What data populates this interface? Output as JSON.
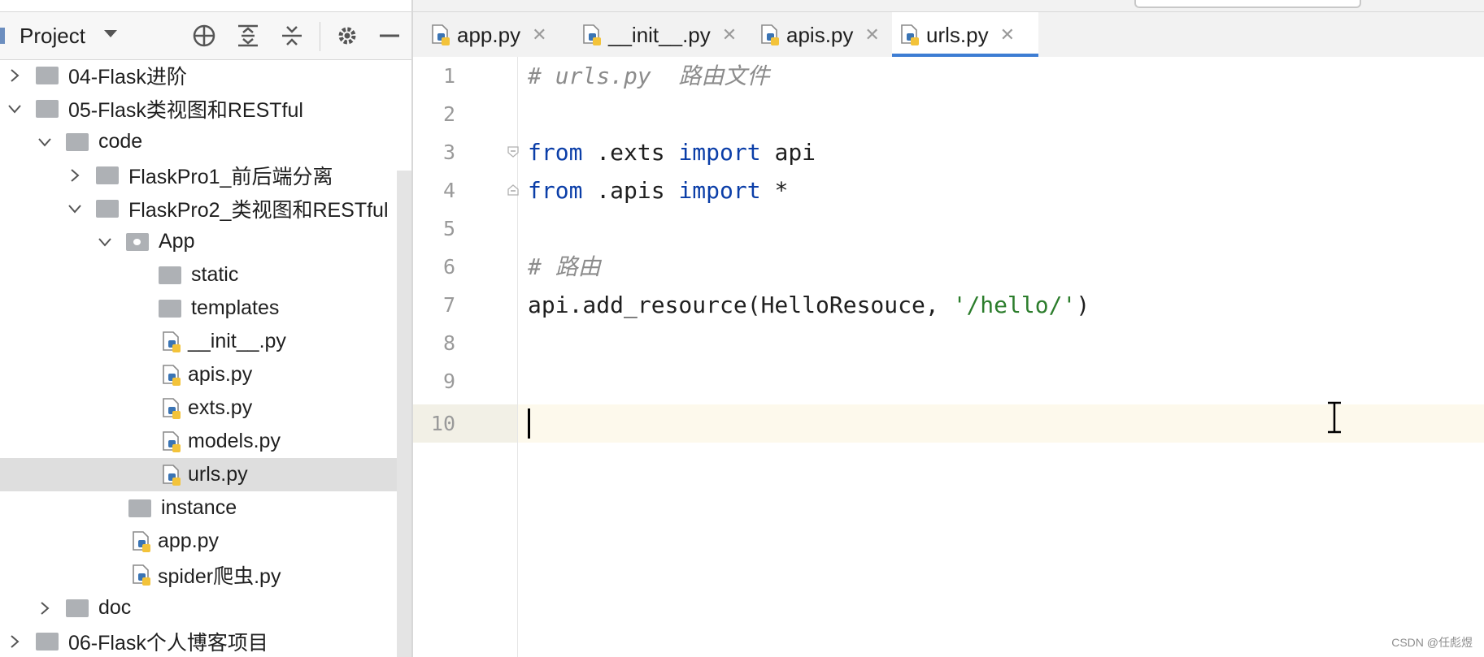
{
  "project_panel": {
    "title": "Project",
    "toolbar_icons": [
      "target-icon",
      "expand-all-icon",
      "collapse-all-icon",
      "gear-icon",
      "minimize-icon"
    ],
    "tree": [
      {
        "label": "04-Flask进阶",
        "type": "folder",
        "level": 0,
        "expanded": false
      },
      {
        "label": "05-Flask类视图和RESTful",
        "type": "folder",
        "level": 0,
        "expanded": true
      },
      {
        "label": "code",
        "type": "folder",
        "level": 1,
        "expanded": true
      },
      {
        "label": "FlaskPro1_前后端分离",
        "type": "folder",
        "level": 2,
        "expanded": false
      },
      {
        "label": "FlaskPro2_类视图和RESTful",
        "type": "folder",
        "level": 2,
        "expanded": true
      },
      {
        "label": "App",
        "type": "package",
        "level": 3,
        "expanded": true
      },
      {
        "label": "static",
        "type": "folder",
        "level": 4
      },
      {
        "label": "templates",
        "type": "folder",
        "level": 4
      },
      {
        "label": "__init__.py",
        "type": "python",
        "level": 4
      },
      {
        "label": "apis.py",
        "type": "python",
        "level": 4
      },
      {
        "label": "exts.py",
        "type": "python",
        "level": 4
      },
      {
        "label": "models.py",
        "type": "python",
        "level": 4
      },
      {
        "label": "urls.py",
        "type": "python",
        "level": 4,
        "selected": true
      },
      {
        "label": "instance",
        "type": "folder",
        "level": 3
      },
      {
        "label": "app.py",
        "type": "python",
        "level": 3
      },
      {
        "label": "spider爬虫.py",
        "type": "python",
        "level": 3
      },
      {
        "label": "doc",
        "type": "folder",
        "level": 1,
        "expanded": false
      },
      {
        "label": "06-Flask个人博客项目",
        "type": "folder",
        "level": 0,
        "expanded": false
      }
    ]
  },
  "tabs": [
    {
      "label": "app.py",
      "active": false
    },
    {
      "label": "__init__.py",
      "active": false
    },
    {
      "label": "apis.py",
      "active": false
    },
    {
      "label": "urls.py",
      "active": true
    }
  ],
  "editor": {
    "line_numbers": [
      "1",
      "2",
      "3",
      "4",
      "5",
      "6",
      "7",
      "8",
      "9",
      "10"
    ],
    "lines": [
      {
        "n": "1",
        "tokens": [
          {
            "t": "# urls.py  路由文件",
            "c": "comment"
          }
        ]
      },
      {
        "n": "2",
        "tokens": []
      },
      {
        "n": "3",
        "tokens": [
          {
            "t": "from",
            "c": "keyword"
          },
          {
            "t": " .exts ",
            "c": "plain"
          },
          {
            "t": "import",
            "c": "keyword"
          },
          {
            "t": " api",
            "c": "plain"
          }
        ]
      },
      {
        "n": "4",
        "tokens": [
          {
            "t": "from",
            "c": "keyword"
          },
          {
            "t": " .apis ",
            "c": "plain"
          },
          {
            "t": "import",
            "c": "keyword"
          },
          {
            "t": " *",
            "c": "plain"
          }
        ]
      },
      {
        "n": "5",
        "tokens": []
      },
      {
        "n": "6",
        "tokens": [
          {
            "t": "# 路由",
            "c": "comment"
          }
        ]
      },
      {
        "n": "7",
        "tokens": [
          {
            "t": "api.add_resource(HelloResouce, ",
            "c": "plain"
          },
          {
            "t": "'/hello/'",
            "c": "string"
          },
          {
            "t": ")",
            "c": "plain"
          }
        ]
      },
      {
        "n": "8",
        "tokens": []
      },
      {
        "n": "9",
        "tokens": []
      },
      {
        "n": "10",
        "tokens": []
      }
    ],
    "caret_line": "10"
  },
  "watermark": "CSDN @任彪煜",
  "colors": {
    "accent": "#3d7dd3",
    "keyword": "#0b3ea8",
    "string": "#2c7d2c",
    "comment": "#8c8c8c",
    "selection": "#dedede",
    "caret_line": "#fdf9ec"
  }
}
